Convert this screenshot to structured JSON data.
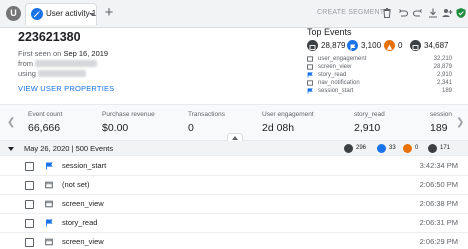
{
  "topbar": {
    "avatar_letter": "U",
    "tab_label": "User activity 1",
    "add_tab": "+",
    "create_segment": "CREATE SEGMENT"
  },
  "user": {
    "id": "223621380",
    "first_seen_prefix": "First seen on",
    "first_seen_date": "Sep 16, 2019",
    "from_prefix": "from",
    "using_prefix": "using",
    "view_properties": "VIEW USER PROPERTIES"
  },
  "top_events": {
    "title": "Top Events",
    "summary": [
      {
        "value": "28,879",
        "icon": "screen-view-icon",
        "color": "#3c4043"
      },
      {
        "value": "3,100",
        "icon": "flag-icon",
        "color": "#1a73e8"
      },
      {
        "value": "0",
        "icon": "warning-icon",
        "color": "#e8710a"
      },
      {
        "value": "34,687",
        "icon": "screen-view-icon",
        "color": "#3c4043"
      }
    ],
    "rows": [
      {
        "name": "user_engagement",
        "count": "32,210",
        "icon": "screen-icon"
      },
      {
        "name": "screen_view",
        "count": "28,879",
        "icon": "screen-icon"
      },
      {
        "name": "story_read",
        "count": "2,910",
        "icon": "flag-icon"
      },
      {
        "name": "nav_notification",
        "count": "2,341",
        "icon": "screen-icon"
      },
      {
        "name": "session_start",
        "count": "189",
        "icon": "flag-icon"
      }
    ]
  },
  "metrics": [
    {
      "label": "Event count",
      "value": "66,666"
    },
    {
      "label": "Purchase revenue",
      "value": "$0.00"
    },
    {
      "label": "Transactions",
      "value": "0"
    },
    {
      "label": "User engagement",
      "value": "2d 08h"
    },
    {
      "label": "story_read",
      "value": "2,910"
    },
    {
      "label": "session",
      "value": "189"
    }
  ],
  "date_header": {
    "text": "May 26, 2020 | 500 Events",
    "chips": [
      {
        "value": "296",
        "color": "#3c4043"
      },
      {
        "value": "33",
        "color": "#1a73e8"
      },
      {
        "value": "0",
        "color": "#e8710a"
      },
      {
        "value": "171",
        "color": "#3c4043"
      }
    ]
  },
  "events": [
    {
      "name": "session_start",
      "time": "3:42:34 PM",
      "icon": "flag-icon"
    },
    {
      "name": "(not set)",
      "time": "2:06:50 PM",
      "icon": "screen-icon"
    },
    {
      "name": "screen_view",
      "time": "2:06:38 PM",
      "icon": "screen-icon"
    },
    {
      "name": "story_read",
      "time": "2:06:31 PM",
      "icon": "flag-icon"
    },
    {
      "name": "screen_view",
      "time": "2:06:29 PM",
      "icon": "screen-icon"
    }
  ]
}
